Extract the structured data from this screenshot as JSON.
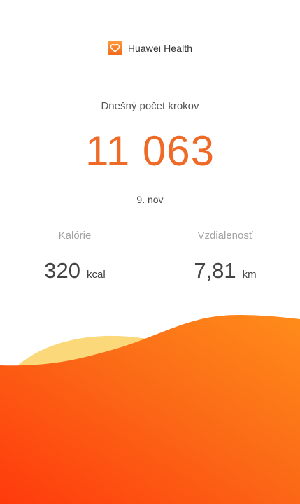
{
  "header": {
    "app_name": "Huawei Health",
    "logo_icon": "heart-icon"
  },
  "steps": {
    "label": "Dnešný počet krokov",
    "value": "11 063",
    "date": "9. nov"
  },
  "stats": {
    "calories": {
      "label": "Kalórie",
      "value": "320",
      "unit": "kcal"
    },
    "distance": {
      "label": "Vzdialenosť",
      "value": "7,81",
      "unit": "km"
    }
  },
  "colors": {
    "accent": "#ee6a26",
    "wave_orange": "#f56a16",
    "wave_yellow": "#fbd97a"
  }
}
